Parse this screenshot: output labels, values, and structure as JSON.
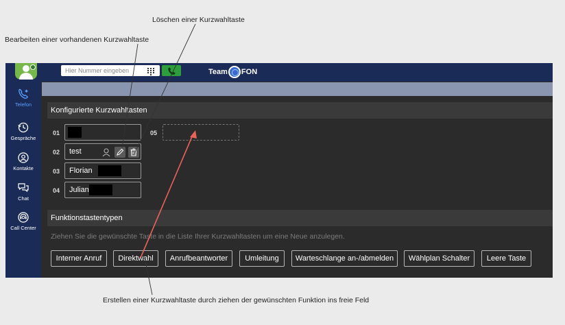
{
  "annotations": {
    "delete_key": "Löschen einer Kurzwahltaste",
    "edit_key": "Bearbeiten einer vorhandenen Kurzwahltaste",
    "create_key": "Erstellen einer Kurzwahltaste durch ziehen der gewünschten Funktion ins freie Feld"
  },
  "topbar": {
    "search_placeholder": "Hier Nummer eingeben",
    "logo_left": "Team",
    "logo_right": "FON"
  },
  "sidebar": {
    "items": [
      {
        "label": "Telefon",
        "icon": "phone-icon",
        "active": true
      },
      {
        "label": "Gespräche",
        "icon": "history-icon",
        "active": false
      },
      {
        "label": "Kontakte",
        "icon": "contacts-icon",
        "active": false
      },
      {
        "label": "Chat",
        "icon": "chat-icon",
        "active": false
      },
      {
        "label": "Call Center",
        "icon": "call-center-icon",
        "active": false
      }
    ]
  },
  "configured": {
    "title": "Konfigurierte Kurzwahltasten",
    "slots": [
      {
        "number": "01",
        "name": ""
      },
      {
        "number": "02",
        "name": "test"
      },
      {
        "number": "03",
        "name": "Florian"
      },
      {
        "number": "04",
        "name": "Julian"
      },
      {
        "number": "05",
        "name": ""
      }
    ]
  },
  "function_types": {
    "title": "Funktionstastentypen",
    "hint": "Ziehen Sie die gewünschte Taste in die Liste Ihrer Kurzwahltasten um eine Neue anzulegen.",
    "buttons": [
      "Interner Anruf",
      "Direktwahl",
      "Anrufbeantworter",
      "Umleitung",
      "Warteschlange an-/abmelden",
      "Wählplan Schalter",
      "Leere Taste"
    ]
  },
  "colors": {
    "nav_bg": "#1a2b58",
    "panel_bg": "#2b2b2b",
    "call_green": "#2e9d3c",
    "active_blue": "#5aa0ff",
    "arrow_red": "#e8645a"
  }
}
